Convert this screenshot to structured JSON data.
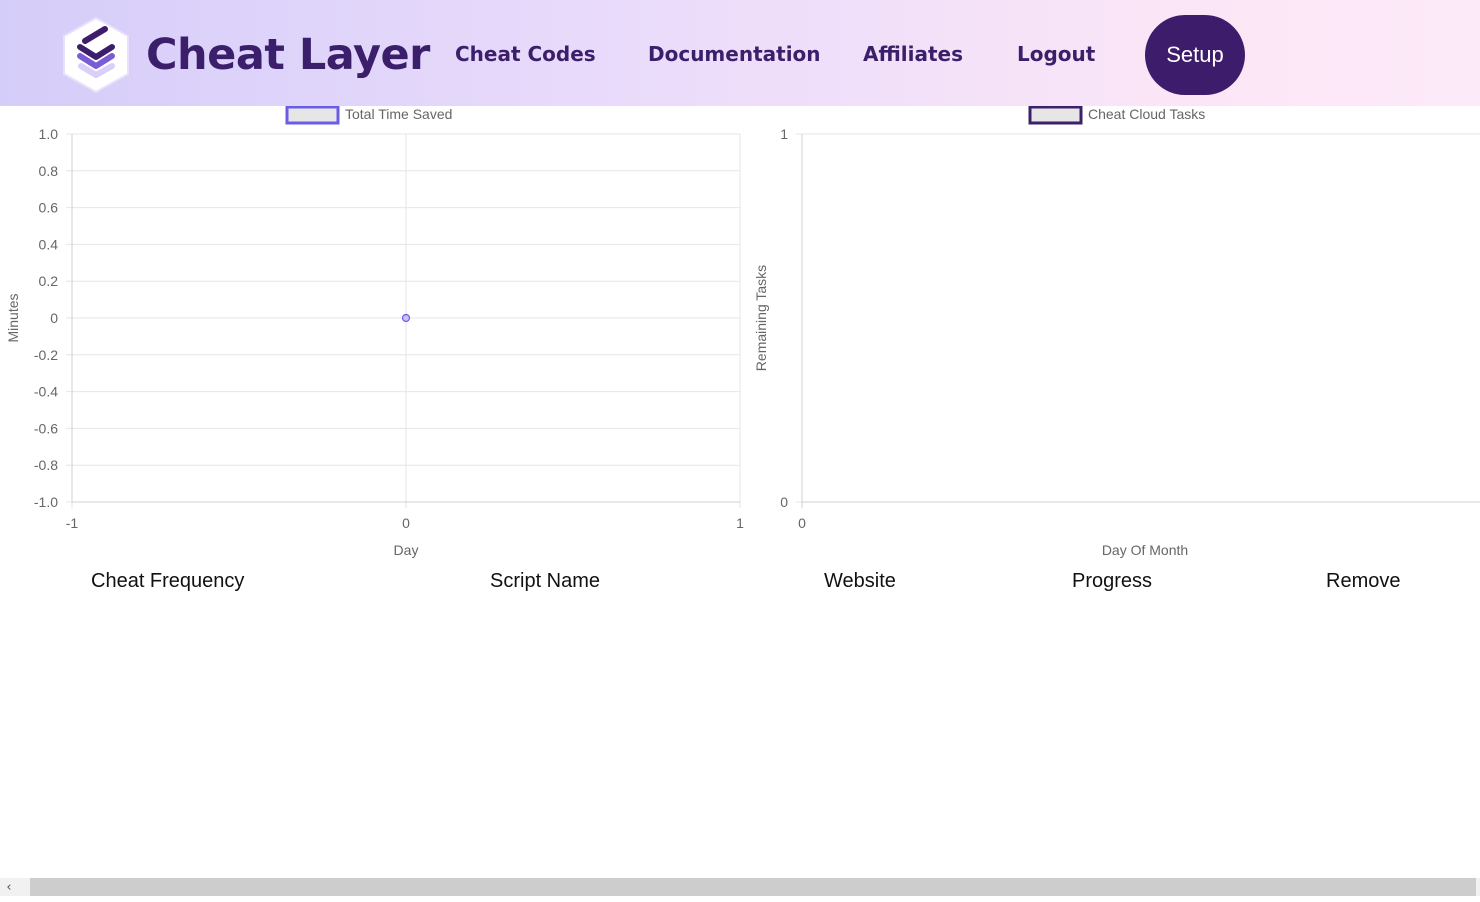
{
  "header": {
    "brand": "Cheat Layer",
    "nav": [
      {
        "label": "Cheat Codes"
      },
      {
        "label": "Documentation"
      },
      {
        "label": "Affiliates"
      },
      {
        "label": "Logout"
      }
    ],
    "setup_label": "Setup"
  },
  "colors": {
    "brand": "#3b1f6b",
    "accent": "#3d1c6b",
    "series1": "#6b5ce7",
    "series2": "#3d1f6b"
  },
  "chart_data": [
    {
      "type": "line",
      "legend": [
        "Total Time Saved"
      ],
      "series": [
        {
          "name": "Total Time Saved",
          "points": [
            {
              "x": 0,
              "y": 0
            }
          ]
        }
      ],
      "xlabel": "Day",
      "ylabel": "Minutes",
      "xlim": [
        -1,
        1
      ],
      "ylim": [
        -1.0,
        1.0
      ],
      "xticks": [
        "-1",
        "0",
        "1"
      ],
      "yticks": [
        "1.0",
        "0.8",
        "0.6",
        "0.4",
        "0.2",
        "0",
        "-0.2",
        "-0.4",
        "-0.6",
        "-0.8",
        "-1.0"
      ],
      "grid": true,
      "legend_position": "top"
    },
    {
      "type": "line",
      "legend": [
        "Cheat Cloud Tasks"
      ],
      "series": [
        {
          "name": "Cheat Cloud Tasks",
          "points": []
        }
      ],
      "xlabel": "Day Of Month",
      "ylabel": "Remaining Tasks",
      "xticks": [
        "0"
      ],
      "yticks": [
        "1",
        "0"
      ],
      "ylim": [
        0,
        1
      ],
      "grid": false,
      "legend_position": "top"
    }
  ],
  "table": {
    "columns": [
      "Cheat Frequency",
      "Script Name",
      "Website",
      "Progress",
      "Remove"
    ]
  },
  "scrollbar": {
    "left_arrow": "‹"
  }
}
